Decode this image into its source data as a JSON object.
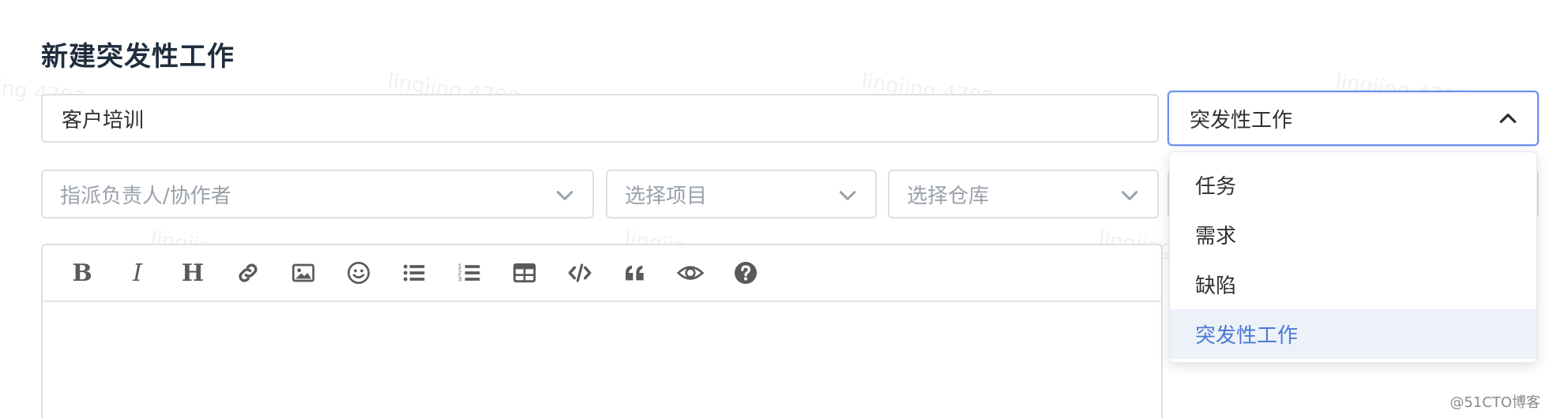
{
  "form": {
    "title": "新建突发性工作",
    "task_name_value": "客户培训",
    "type_select": {
      "selected": "突发性工作",
      "expanded": true
    },
    "assignee_placeholder": "指派负责人/协作者",
    "project_placeholder": "选择项目",
    "repo_placeholder": "选择仓库",
    "type_options": [
      "任务",
      "需求",
      "缺陷",
      "突发性工作"
    ]
  },
  "editor_toolbar": {
    "bold_label": "B",
    "italic_label": "I",
    "heading_label": "H",
    "tools": [
      "bold",
      "italic",
      "heading",
      "link-icon",
      "image-icon",
      "emoji-icon",
      "bullet-list-icon",
      "numbered-list-icon",
      "table-icon",
      "code-icon",
      "quote-icon",
      "preview-eye-icon",
      "help-icon"
    ]
  },
  "watermark": "lingjing 4792",
  "corner_mark": "@51CTO博客",
  "colors": {
    "accent": "#6a8ff0",
    "selected_option_bg": "#edf1f8",
    "selected_option_text": "#4a7ad3",
    "title": "#1f2d3d"
  }
}
